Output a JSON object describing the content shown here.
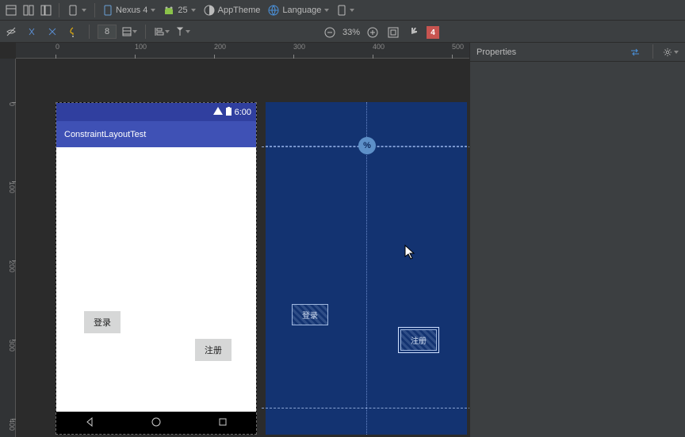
{
  "toolbar": {
    "device": "Nexus 4",
    "api": "25",
    "theme": "AppTheme",
    "lang": "Language",
    "margin": "8",
    "zoom": "33%"
  },
  "device": {
    "status_time": "6:00",
    "app_title": "ConstraintLayoutTest",
    "btn_login": "登录",
    "btn_register": "注册"
  },
  "blueprint": {
    "btn_login": "登录",
    "btn_register": "注册",
    "percent": "%"
  },
  "props": {
    "title": "Properties",
    "errors": "4"
  },
  "ruler": {
    "h": [
      "0",
      "100",
      "200",
      "300",
      "400",
      "500"
    ],
    "v": [
      "0",
      "100",
      "200",
      "300",
      "400"
    ]
  }
}
